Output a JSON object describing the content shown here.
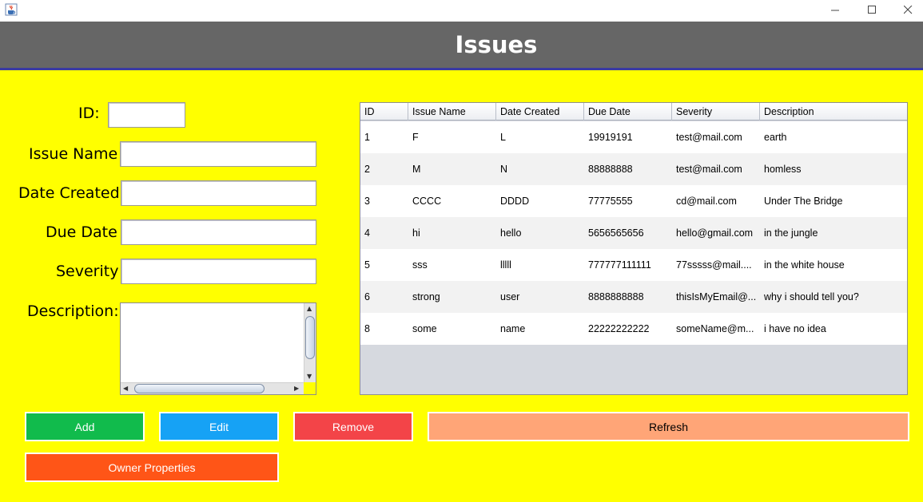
{
  "window": {
    "icons": {
      "app": "java-cup-icon",
      "minimize": "minimize-icon",
      "maximize": "maximize-icon",
      "close": "close-icon"
    }
  },
  "header": {
    "title": "Issues",
    "background": "#666666",
    "accent": "#3a3aa0"
  },
  "form": {
    "id_label": "ID:",
    "issue_name_label": "Issue Name",
    "date_created_label": "Date Created",
    "due_date_label": "Due Date",
    "severity_label": "Severity",
    "description_label": "Description:",
    "id_value": "",
    "issue_name_value": "",
    "date_created_value": "",
    "due_date_value": "",
    "severity_value": "",
    "description_value": ""
  },
  "table": {
    "columns": [
      "ID",
      "Issue Name",
      "Date Created",
      "Due Date",
      "Severity",
      "Description"
    ],
    "rows": [
      [
        "1",
        "F",
        "L",
        "19919191",
        "test@mail.com",
        "earth"
      ],
      [
        "2",
        "M",
        "N",
        "88888888",
        "test@mail.com",
        "homless"
      ],
      [
        "3",
        "CCCC",
        "DDDD",
        "77775555",
        "cd@mail.com",
        "Under The Bridge"
      ],
      [
        "4",
        "hi",
        "hello",
        "5656565656",
        "hello@gmail.com",
        "in the jungle"
      ],
      [
        "5",
        "sss",
        "lllll",
        "777777111111",
        "77sssss@mail....",
        "in the white house"
      ],
      [
        "6",
        "strong",
        "user",
        "8888888888",
        "thisIsMyEmail@...",
        "why i should tell you?"
      ],
      [
        "8",
        "some",
        "name",
        "22222222222",
        "someName@m...",
        "i have no idea"
      ]
    ]
  },
  "buttons": {
    "add": "Add",
    "edit": "Edit",
    "remove": "Remove",
    "refresh": "Refresh",
    "owner_properties": "Owner Properties"
  },
  "colors": {
    "background": "#ffff00",
    "add": "#11bb4c",
    "edit": "#16a2f5",
    "remove": "#f34448",
    "refresh": "#ffa577",
    "owner_properties": "#ff5517"
  }
}
